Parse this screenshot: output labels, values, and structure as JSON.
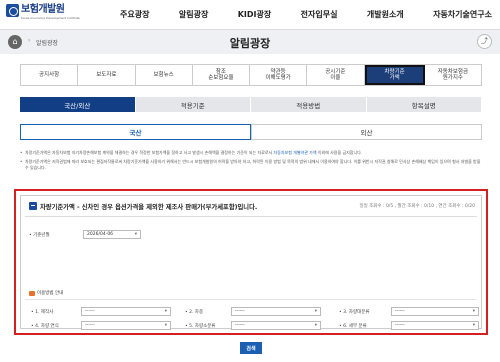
{
  "header": {
    "logo_text": "보험개발원",
    "logo_sub": "Korea Insurance Development Institute",
    "menu": [
      "주요광장",
      "알림광장",
      "KIDI광장",
      "전자입무실",
      "개발원소개",
      "자동차기술연구소"
    ]
  },
  "titlebar": {
    "breadcrumb": "알림광장",
    "title": "알림광장",
    "home_icon": "⌂",
    "share_icon": "⤴"
  },
  "subtabs": [
    {
      "label": "공지사항",
      "active": false
    },
    {
      "label": "보도자료",
      "active": false
    },
    {
      "label": "보험뉴스",
      "active": false
    },
    {
      "label": "참조\n순보험요율",
      "active": false
    },
    {
      "label": "약관등\n이해도평가",
      "active": false
    },
    {
      "label": "공시기준\n이율",
      "active": false
    },
    {
      "label": "차량기준\n가액",
      "active": true
    },
    {
      "label": "자동차보험금\n원가지수",
      "active": false
    }
  ],
  "category_tabs": [
    {
      "label": "국산/외산",
      "active": true
    },
    {
      "label": "적용기준",
      "active": false
    },
    {
      "label": "적용방법",
      "active": false
    },
    {
      "label": "항목설명",
      "active": false
    }
  ],
  "origin_tabs": [
    {
      "label": "국산",
      "active": true
    },
    {
      "label": "외산",
      "active": false
    }
  ],
  "notes": [
    {
      "text": "차량기준가액은 자동차보험 자기차량손해보험 계약을 체결하는 경우 적정한 보험가액을 정하고 사고 발생시 손해액을 결정하는 기준이 되는 자료로서 ",
      "link": "자동차보험 개별약관 가액",
      "tail": " 이외에 사용을 금지합니다."
    },
    {
      "text": "차량기준가액은 저작권법에 따라 보호되는 편집저작물로써 차량기준가액을 사용하기 위해서는 반드시 보험개발원의 허락을 받아야 하고, 허락된 이용 방법 및 목적의 범위 내에서 이용하여야 합니다. 이를 위반시 저작권 침해로 민사상 손해배상 책임이 있으며 형사 처벌을 받을 수 있습니다.",
      "link": "",
      "tail": ""
    }
  ],
  "form": {
    "title": "차량기준가액 - 신차인 경우 옵션가격을 제외한 제조사 판매가(부가세포함)입니다.",
    "counts": "일일 조회수 : 0/5 , 월간 조회수 : 0/10 , 연간 조회수 : 0/20",
    "date_label": "• 기준년월",
    "date_value": "2026/04-06",
    "usage_label": "이용방법 안내",
    "fields": [
      {
        "label": "• 1. 제작사",
        "value": "------"
      },
      {
        "label": "• 2. 차종",
        "value": "------"
      },
      {
        "label": "• 3. 차량대분류",
        "value": "------"
      },
      {
        "label": "• 4. 차량 연식",
        "value": "------"
      },
      {
        "label": "• 5. 차량소분류",
        "value": "------"
      },
      {
        "label": "• 6. 세부 분류",
        "value": "------"
      }
    ],
    "arrow": "▾",
    "search_label": "검색"
  },
  "colors": {
    "accent": "#123e85",
    "highlight": "#d32020",
    "usage_icon": "#e8742c"
  }
}
